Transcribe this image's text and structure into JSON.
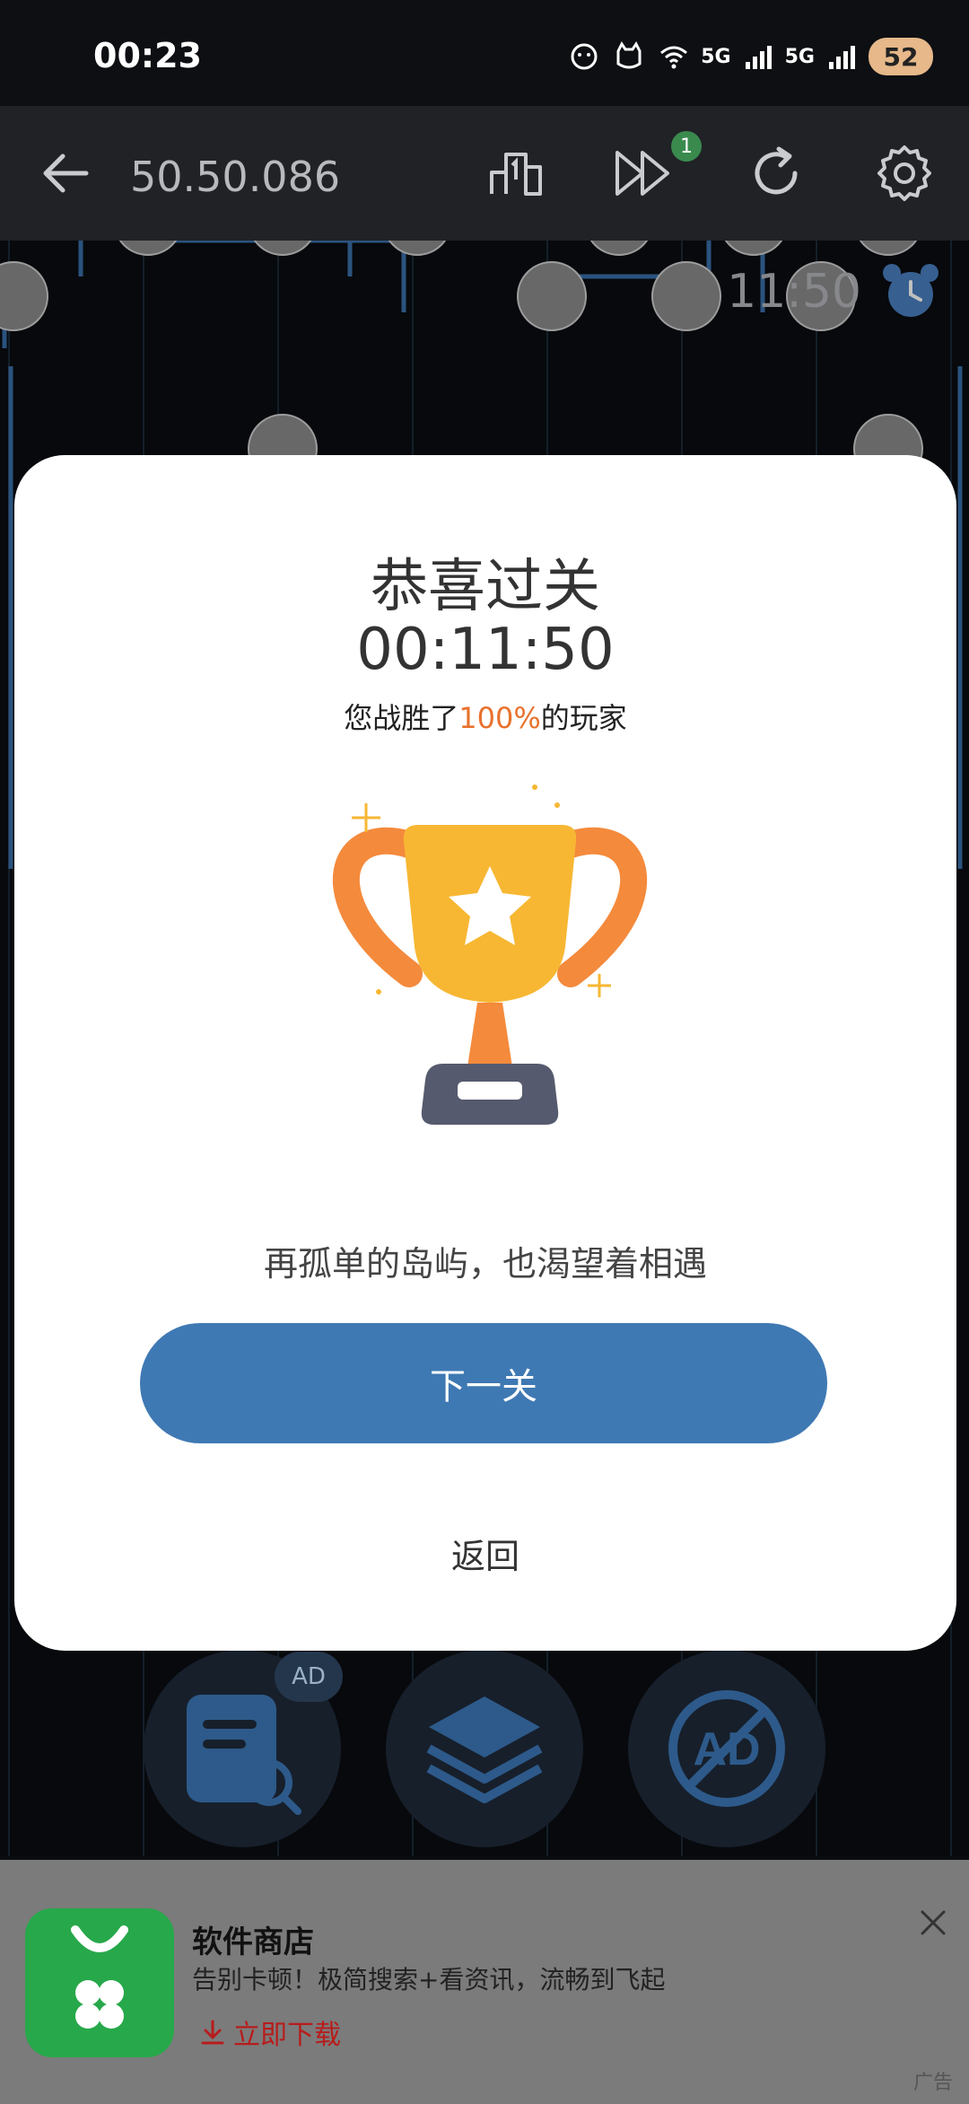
{
  "status_bar": {
    "time": "00:23",
    "network_1": "5G",
    "network_2": "5G",
    "battery": "52"
  },
  "toolbar": {
    "level": "50.50.086",
    "skip_badge": "1",
    "icons": [
      "back-arrow-icon",
      "leaderboard-icon",
      "skip-icon",
      "restart-icon",
      "settings-icon"
    ]
  },
  "game": {
    "timer": "11:50"
  },
  "dialog": {
    "title": "恭喜过关",
    "elapsed": "00:11:50",
    "beat_prefix": "您战胜了",
    "beat_percent": "100%",
    "beat_suffix": "的玩家",
    "quote": "再孤单的岛屿，也渴望着相遇",
    "next_label": "下一关",
    "back_label": "返回"
  },
  "bottom_buttons": {
    "ad_badge": "AD",
    "items": [
      "hint-icon",
      "layers-icon",
      "no-ad-icon"
    ]
  },
  "ad_banner": {
    "app_name": "软件商店",
    "description": "告别卡顿！极简搜索+看资讯，流畅到飞起",
    "cta": "立即下载",
    "tag": "广告"
  },
  "colors": {
    "accent_blue": "#3f79b3",
    "highlight_orange": "#e8722d",
    "trophy_gold": "#f7b733",
    "trophy_orange": "#f48a3c"
  }
}
